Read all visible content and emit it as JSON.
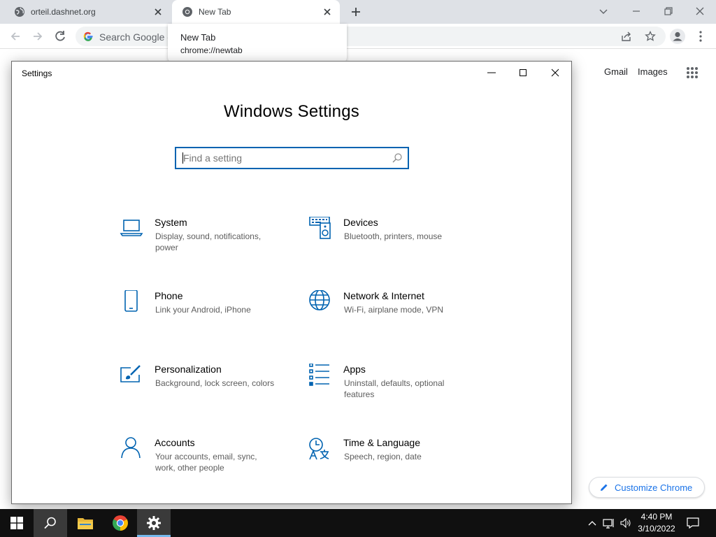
{
  "browser": {
    "tabs": [
      {
        "label": "orteil.dashnet.org",
        "active": false
      },
      {
        "label": "New Tab",
        "active": true
      }
    ],
    "omnibox_placeholder": "Search Google or type a URL",
    "omnibox_visible_text": "Search Google o",
    "tooltip": {
      "title": "New Tab",
      "url": "chrome://newtab"
    },
    "links": {
      "gmail": "Gmail",
      "images": "Images"
    },
    "customize_label": "Customize Chrome"
  },
  "settings": {
    "window_title": "Settings",
    "heading": "Windows Settings",
    "search_placeholder": "Find a setting",
    "tiles": [
      {
        "name": "System",
        "desc": "Display, sound, notifications, power",
        "icon": "laptop-icon"
      },
      {
        "name": "Devices",
        "desc": "Bluetooth, printers, mouse",
        "icon": "keyboard-speaker-icon"
      },
      {
        "name": "Phone",
        "desc": "Link your Android, iPhone",
        "icon": "phone-icon"
      },
      {
        "name": "Network & Internet",
        "desc": "Wi-Fi, airplane mode, VPN",
        "icon": "globe-icon"
      },
      {
        "name": "Personalization",
        "desc": "Background, lock screen, colors",
        "icon": "paint-brush-icon"
      },
      {
        "name": "Apps",
        "desc": "Uninstall, defaults, optional features",
        "icon": "apps-list-icon"
      },
      {
        "name": "Accounts",
        "desc": "Your accounts, email, sync, work, other people",
        "icon": "person-icon"
      },
      {
        "name": "Time & Language",
        "desc": "Speech, region, date",
        "icon": "time-language-icon"
      }
    ]
  },
  "taskbar": {
    "time": "4:40 PM",
    "date": "3/10/2022"
  },
  "colors": {
    "accent": "#0063b1",
    "chrome_blue": "#1a73e8",
    "taskbar": "#101010"
  }
}
